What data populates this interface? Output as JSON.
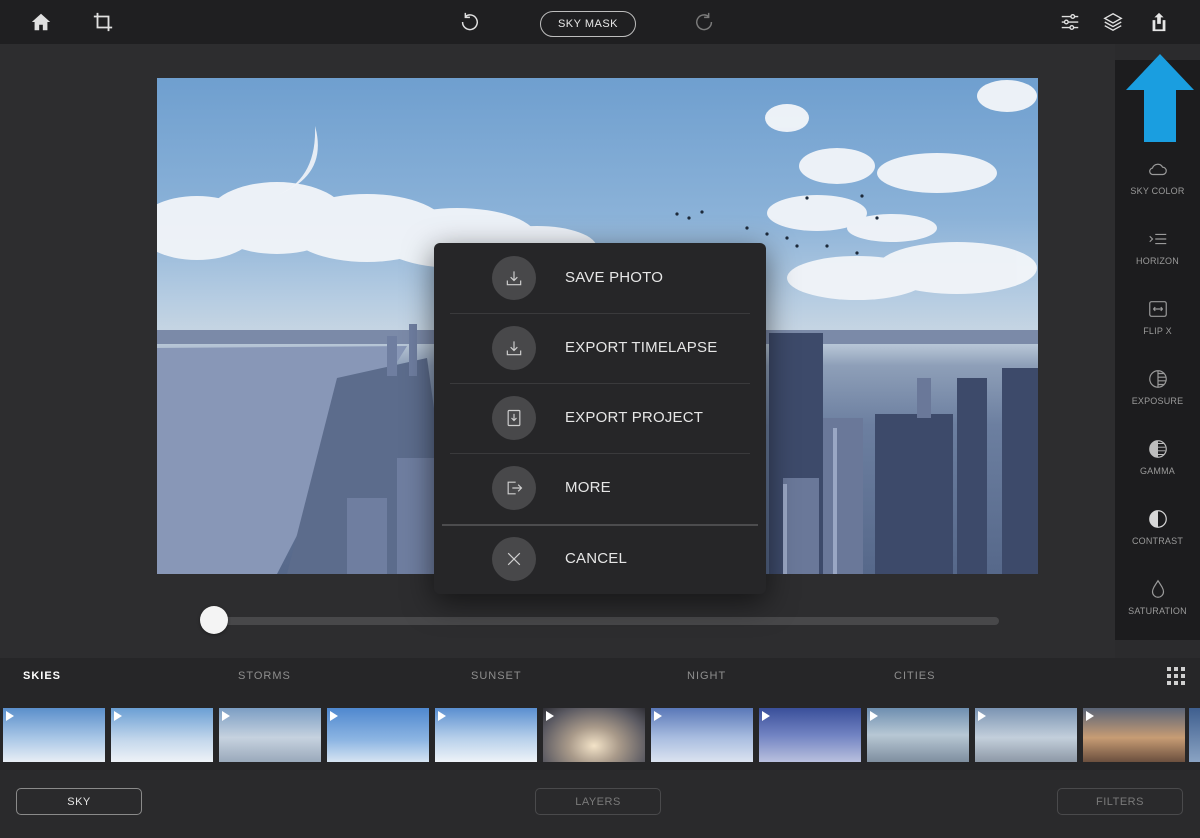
{
  "topbar": {
    "sky_mask_label": "SKY MASK",
    "icons": [
      "home-icon",
      "crop-icon",
      "undo-icon",
      "redo-icon",
      "sliders-icon",
      "layers-icon",
      "share-icon"
    ]
  },
  "right_panel": {
    "items": [
      {
        "label": "SKY COLOR",
        "icon": "cloud-icon"
      },
      {
        "label": "HORIZON",
        "icon": "horizon-icon"
      },
      {
        "label": "FLIP X",
        "icon": "flip-icon"
      },
      {
        "label": "EXPOSURE",
        "icon": "exposure-icon"
      },
      {
        "label": "GAMMA",
        "icon": "gamma-icon"
      },
      {
        "label": "CONTRAST",
        "icon": "contrast-icon"
      },
      {
        "label": "SATURATION",
        "icon": "droplet-icon"
      }
    ]
  },
  "export_menu": {
    "items": [
      {
        "label": "SAVE PHOTO",
        "icon": "download-icon"
      },
      {
        "label": "EXPORT TIMELAPSE",
        "icon": "download-icon"
      },
      {
        "label": "EXPORT PROJECT",
        "icon": "import-icon"
      },
      {
        "label": "MORE",
        "icon": "export-icon"
      },
      {
        "label": "CANCEL",
        "icon": "close-icon"
      }
    ]
  },
  "slider": {
    "value": 0
  },
  "categories": {
    "items": [
      "SKIES",
      "STORMS",
      "SUNSET",
      "NIGHT",
      "CITIES"
    ],
    "active": "SKIES"
  },
  "bottom": {
    "sky_label": "SKY",
    "layers_label": "LAYERS",
    "filters_label": "FILTERS"
  },
  "colors": {
    "accent_arrow": "#1a9ee0",
    "background": "#2b2b2d",
    "modal": "#262628"
  }
}
